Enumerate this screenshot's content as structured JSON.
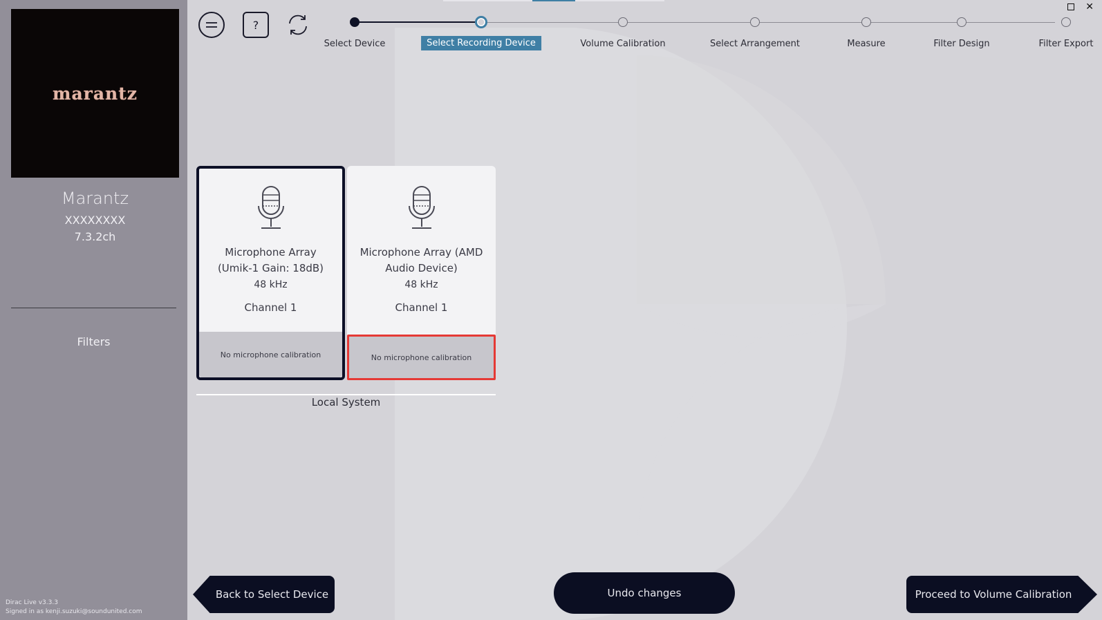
{
  "sidebar": {
    "logo_text": "marantz",
    "device_name": "Marantz",
    "device_serial": "XXXXXXXX",
    "device_channels": "7.3.2ch",
    "filters_label": "Filters",
    "version": "Dirac Live v3.3.3",
    "signed_in": "Signed in as kenji.suzuki@soundunited.com"
  },
  "window": {
    "close_glyph": "✕"
  },
  "toolbar": {
    "help_label": "?"
  },
  "stepper": {
    "steps": [
      {
        "label": "Select Device",
        "state": "done"
      },
      {
        "label": "Select Recording Device",
        "state": "active"
      },
      {
        "label": "Volume Calibration",
        "state": "todo"
      },
      {
        "label": "Select Arrangement",
        "state": "todo"
      },
      {
        "label": "Measure",
        "state": "todo"
      },
      {
        "label": "Filter Design",
        "state": "todo"
      },
      {
        "label": "Filter Export",
        "state": "todo"
      }
    ]
  },
  "devices": {
    "group_label": "Local System",
    "cards": [
      {
        "title_line1": "Microphone Array",
        "title_line2": "(Umik-1  Gain: 18dB)",
        "sample_rate": "48 kHz",
        "channel": "Channel 1",
        "calibration": "No microphone calibration",
        "selected": true
      },
      {
        "title_line1": "Microphone Array (AMD",
        "title_line2": "Audio Device)",
        "sample_rate": "48 kHz",
        "channel": "Channel 1",
        "calibration": "No microphone calibration",
        "selected": false
      }
    ]
  },
  "footer": {
    "back_label": "Back to Select Device",
    "undo_label": "Undo changes",
    "proceed_label": "Proceed to Volume Calibration"
  },
  "colors": {
    "accent": "#3f7fa5",
    "button_dark": "#0b0e22",
    "highlight": "#e53935",
    "sidebar_bg": "#928f99",
    "main_bg": "#d4d3d8"
  },
  "icons": [
    "menu-icon",
    "help-icon",
    "refresh-icon",
    "microphone-icon",
    "maximize-icon",
    "close-icon"
  ]
}
